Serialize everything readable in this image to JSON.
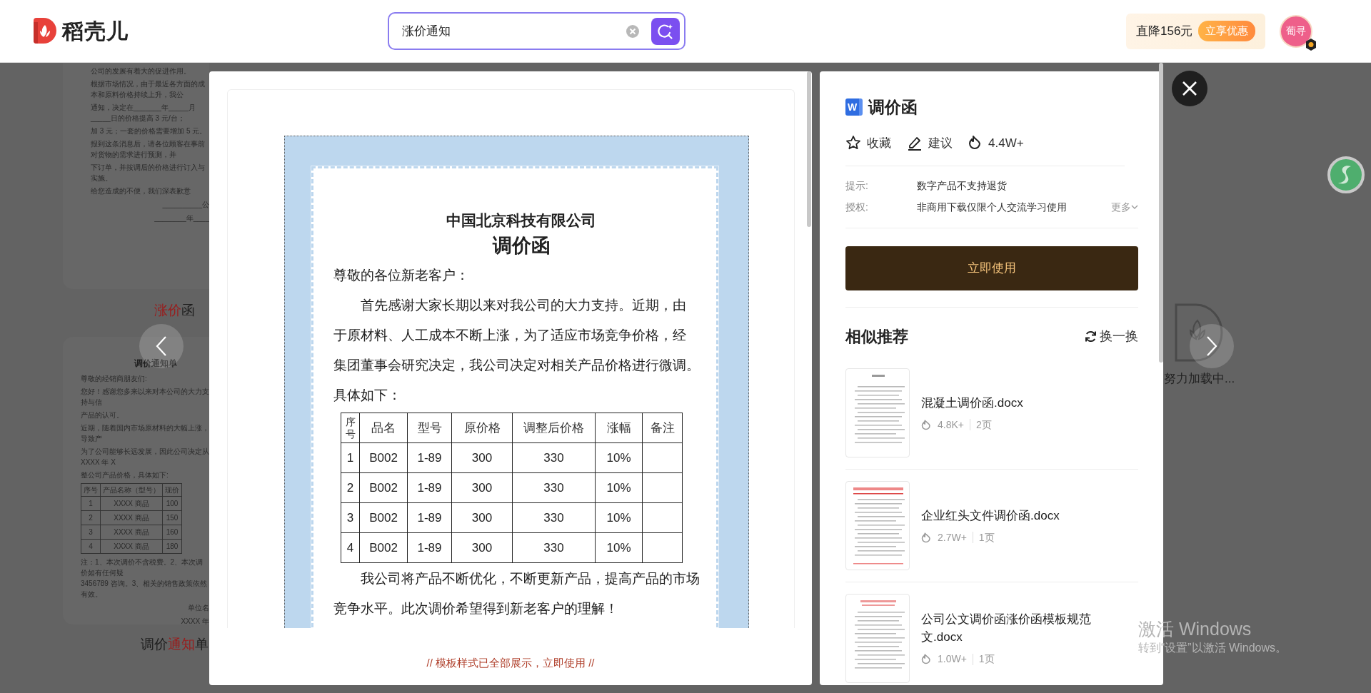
{
  "header": {
    "logo_text": "稻壳儿",
    "search": {
      "value": "涨价通知"
    },
    "promo": {
      "text": "直降156元",
      "button": "立享优惠"
    },
    "avatar": {
      "initials": "葡寻"
    }
  },
  "background": {
    "cards": [
      {
        "lines": [
          "公司的发展有着大的促进作用。",
          "根据市场情况，由于最近各方面的成本和原料价格持续上升，我公",
          "通知，决定在_______年_____月_____日的价格提高 3 元/台；",
          "加 3 元；一套的价格需要增加 5 元。",
          "报到这条消息后，请各位顾客在事前对货物的需求进行预测，并",
          "下订单，并按调后的价格进行订入与实施。",
          "给您造成的不便，我们深表歉意"
        ],
        "signature": [
          "__________公",
          "________年____"
        ],
        "caption": [
          {
            "text": "涨价",
            "highlight": true
          },
          {
            "text": "函",
            "highlight": false
          }
        ]
      },
      {
        "title": "调价通知单",
        "lines": [
          "尊敬的经销商朋友们:",
          "您好！感谢您多来以来对本公司的大力支持与信",
          "产品的认可。",
          "近期，随着国内市场原材料的大幅上涨，导致产",
          "为了公司能够长远发展，因此公司决定从 XXXX 年 X",
          "整公司产品价格，具体如下:"
        ],
        "table": {
          "columns": [
            "序号",
            "产品名称（型号）",
            "现价"
          ],
          "rows": [
            [
              "1",
              "XXXX 商品",
              "100"
            ],
            [
              "2",
              "XXXX 商品",
              "150"
            ],
            [
              "3",
              "XXXX 商品",
              "160"
            ],
            [
              "4",
              "XXXX 商品",
              "180"
            ]
          ]
        },
        "notes": [
          "注：1、本次调价不含税费。2、本次调价如有任何疑",
          "3456789 咨询。3、相关的销售政策依然有效。"
        ],
        "signature": [
          "单位名",
          "XXXX 年"
        ],
        "caption": [
          {
            "text": "调价",
            "highlight": false
          },
          {
            "text": "通知",
            "highlight": true
          },
          {
            "text": "单",
            "highlight": false
          }
        ]
      }
    ],
    "loading_text": "努力加载中..."
  },
  "preview": {
    "document": {
      "company": "中国北京科技有限公司",
      "title": "调价函",
      "greeting": "尊敬的各位新老客户：",
      "lines": [
        {
          "text": "首先感谢大家长期以来对我公司的大力支持。近期，由",
          "indent": true
        },
        {
          "text": "于原材料、人工成本不断上涨，为了适应市场竞争价格，经",
          "indent": false
        },
        {
          "text": "集团董事会研究决定，我公司决定对相关产品价格进行微调。",
          "indent": false
        },
        {
          "text": "具体如下：",
          "indent": false
        }
      ],
      "table": {
        "columns": [
          "序号",
          "品名",
          "型号",
          "原价格",
          "调整后价格",
          "涨幅",
          "备注"
        ],
        "rows": [
          [
            "1",
            "B002",
            "1-89",
            "300",
            "330",
            "10%",
            ""
          ],
          [
            "2",
            "B002",
            "1-89",
            "300",
            "330",
            "10%",
            ""
          ],
          [
            "3",
            "B002",
            "1-89",
            "300",
            "330",
            "10%",
            ""
          ],
          [
            "4",
            "B002",
            "1-89",
            "300",
            "330",
            "10%",
            ""
          ]
        ]
      },
      "closing": [
        {
          "text": "我公司将产品不断优化，不断更新产品，提高产品的市场",
          "indent": true
        },
        {
          "text": "竞争水平。此次调价希望得到新老客户的理解！",
          "indent": false
        }
      ]
    },
    "footer": "// 模板样式已全部展示，立即使用 //"
  },
  "details": {
    "file_badge": "W",
    "title": "调价函",
    "actions": [
      {
        "kind": "favorite",
        "label": "收藏"
      },
      {
        "kind": "suggest",
        "label": "建议"
      },
      {
        "kind": "views",
        "label": "4.4W+"
      }
    ],
    "info": [
      {
        "label": "提示:",
        "value": "数字产品不支持退货"
      },
      {
        "label": "授权:",
        "value": "非商用下载仅限个人交流学习使用",
        "more": "更多"
      }
    ],
    "use_button": "立即使用",
    "similar": {
      "title": "相似推荐",
      "refresh": "换一换",
      "items": [
        {
          "name": "混凝土调价函.docx",
          "views": "4.8K+",
          "pages": "2页",
          "kind": "plain"
        },
        {
          "name": "企业红头文件调价函.docx",
          "views": "2.7W+",
          "pages": "1页",
          "kind": "red-header"
        },
        {
          "name": "公司公文调价函涨价函模板规范文.docx",
          "views": "1.0W+",
          "pages": "1页",
          "kind": "red-title"
        }
      ]
    }
  },
  "system": {
    "watermark_title": "激活 Windows",
    "watermark_text": "转到“设置”以激活 Windows。"
  }
}
